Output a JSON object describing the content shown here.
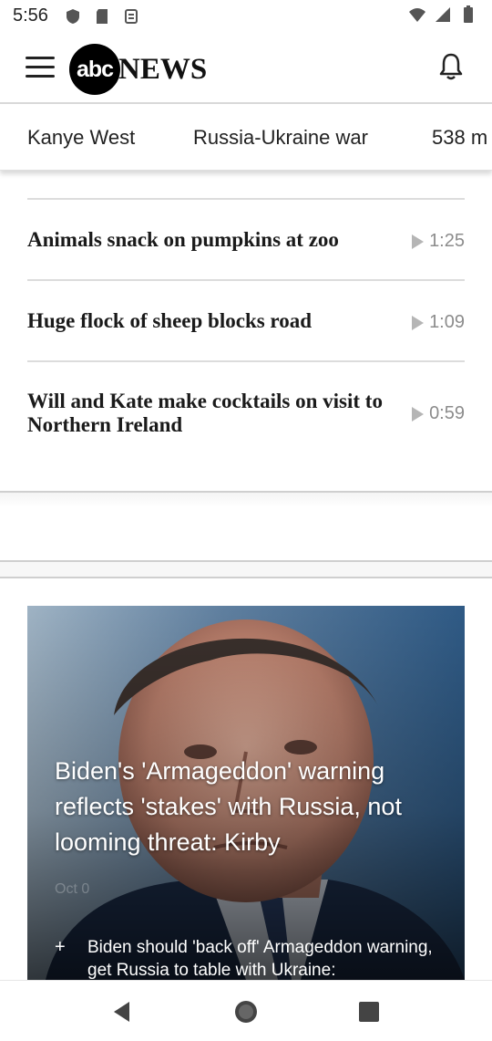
{
  "status_bar": {
    "time": "5:56"
  },
  "header": {
    "logo_abc": "abc",
    "logo_news": "NEWS"
  },
  "topics": [
    "Kanye West",
    "Russia-Ukraine war",
    "538 m"
  ],
  "videos": [
    {
      "title": "Animals snack on pumpkins at zoo",
      "duration": "1:25"
    },
    {
      "title": "Huge flock of sheep blocks road",
      "duration": "1:09"
    },
    {
      "title": "Will and Kate make cocktails on visit to Northern Ireland",
      "duration": "0:59"
    }
  ],
  "hero": {
    "headline": "Biden's 'Armageddon' warning reflects 'stakes' with Russia, not looming threat: Kirby",
    "date": "Oct 0",
    "related_prefix": "+",
    "related": "Biden should 'back off' Armageddon warning, get Russia to table with Ukraine:"
  },
  "colors": {
    "accent": "#000000",
    "divider": "#dcdcdc",
    "hero_bg": "#4a6f93"
  },
  "icons": {
    "menu": "hamburger-icon",
    "notifications": "bell-icon",
    "play": "play-icon",
    "nav_back": "back-triangle-icon",
    "nav_home": "home-circle-icon",
    "nav_recent": "recent-square-icon"
  }
}
